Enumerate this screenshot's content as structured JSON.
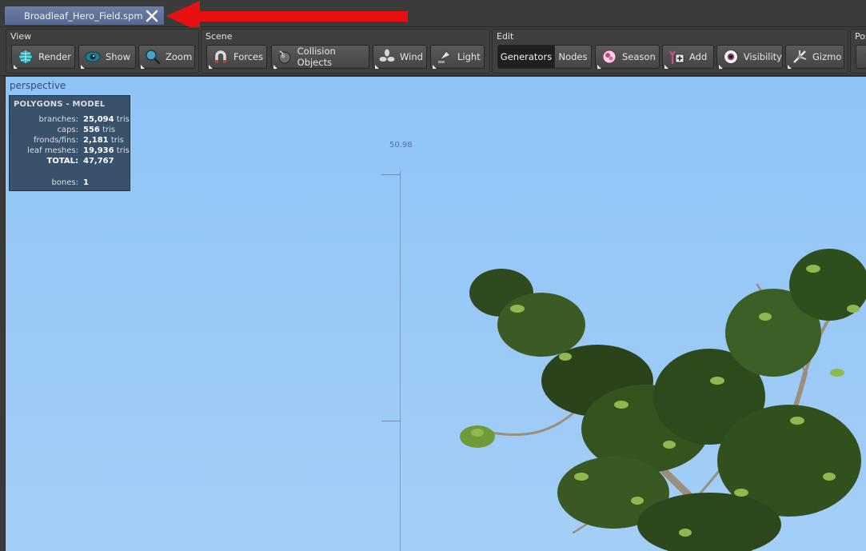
{
  "tab": {
    "title": "Broadleaf_Hero_Field.spm",
    "close_icon": "close-icon"
  },
  "toolbar": {
    "view": {
      "label": "View",
      "render": "Render",
      "show": "Show",
      "zoom": "Zoom"
    },
    "scene": {
      "label": "Scene",
      "forces": "Forces",
      "collision": "Collision Objects",
      "wind": "Wind",
      "light": "Light"
    },
    "edit": {
      "label": "Edit",
      "generators": "Generators",
      "nodes": "Nodes",
      "season": "Season",
      "add": "Add",
      "visibility": "Visibility",
      "gizmo": "Gizmo"
    },
    "pos": {
      "label": "Pos"
    }
  },
  "viewport": {
    "camera": "perspective",
    "ruler_value": "50.98",
    "stats": {
      "title": "POLYGONS - MODEL",
      "rows": [
        {
          "key": "branches:",
          "value": "25,094",
          "unit": "tris"
        },
        {
          "key": "caps:",
          "value": "556",
          "unit": "tris"
        },
        {
          "key": "fronds/fins:",
          "value": "2,181",
          "unit": "tris"
        },
        {
          "key": "leaf meshes:",
          "value": "19,936",
          "unit": "tris"
        },
        {
          "key": "TOTAL:",
          "value": "47,767",
          "unit": ""
        },
        {
          "key": "bones:",
          "value": "1",
          "unit": ""
        }
      ]
    }
  },
  "colors": {
    "sky": "#9ccaf6",
    "annotation_arrow": "#e81010",
    "tab": "#5f7198"
  }
}
